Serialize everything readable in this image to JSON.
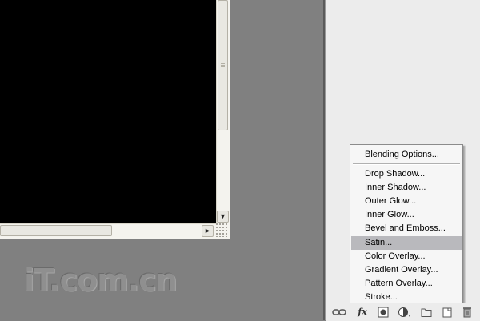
{
  "watermark": {
    "text": "iT.com.cn"
  },
  "document": {
    "scroll_down_glyph": "▼",
    "scroll_right_glyph": "►"
  },
  "layer_style_menu": {
    "items": [
      {
        "label": "Blending Options...",
        "selected": false
      },
      {
        "label": "Drop Shadow...",
        "selected": false
      },
      {
        "label": "Inner Shadow...",
        "selected": false
      },
      {
        "label": "Outer Glow...",
        "selected": false
      },
      {
        "label": "Inner Glow...",
        "selected": false
      },
      {
        "label": "Bevel and Emboss...",
        "selected": false
      },
      {
        "label": "Satin...",
        "selected": true
      },
      {
        "label": "Color Overlay...",
        "selected": false
      },
      {
        "label": "Gradient Overlay...",
        "selected": false
      },
      {
        "label": "Pattern Overlay...",
        "selected": false
      },
      {
        "label": "Stroke...",
        "selected": false
      }
    ]
  },
  "layers_toolbar": {
    "fx_label": "fx",
    "icons": [
      "link-icon",
      "fx-icon",
      "mask-icon",
      "adjustment-icon",
      "folder-icon",
      "new-layer-icon",
      "trash-icon"
    ]
  },
  "colors": {
    "canvas": "#000000",
    "workspace": "#808080",
    "menu_highlight": "#b9b9bd",
    "panel": "#ececec"
  }
}
